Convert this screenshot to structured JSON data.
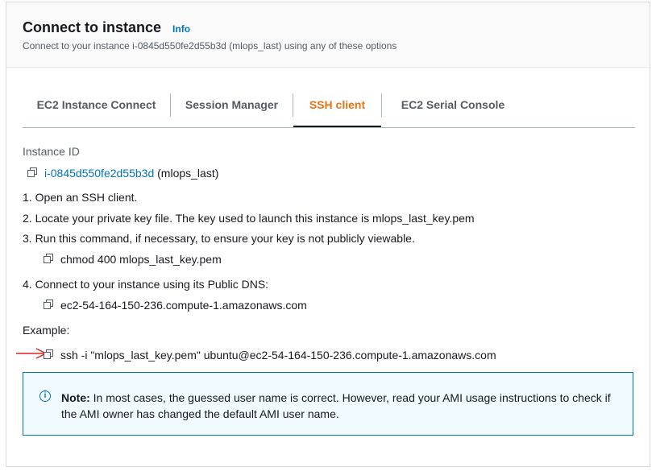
{
  "header": {
    "title": "Connect to instance",
    "info_link": "Info",
    "subtitle": "Connect to your instance i-0845d550fe2d55b3d (mlops_last) using any of these options"
  },
  "tabs": [
    {
      "label": "EC2 Instance Connect",
      "active": false
    },
    {
      "label": "Session Manager",
      "active": false
    },
    {
      "label": "SSH client",
      "active": true
    },
    {
      "label": "EC2 Serial Console",
      "active": false
    }
  ],
  "instance": {
    "label": "Instance ID",
    "id": "i-0845d550fe2d55b3d",
    "name": "(mlops_last)"
  },
  "steps": [
    "1. Open an SSH client.",
    "2. Locate your private key file. The key used to launch this instance is mlops_last_key.pem",
    "3. Run this command, if necessary, to ensure your key is not publicly viewable.",
    "4. Connect to your instance using its Public DNS:"
  ],
  "chmod_command": "chmod 400 mlops_last_key.pem",
  "public_dns": "ec2-54-164-150-236.compute-1.amazonaws.com",
  "example": {
    "label": "Example:",
    "command": "ssh -i \"mlops_last_key.pem\" ubuntu@ec2-54-164-150-236.compute-1.amazonaws.com"
  },
  "note": {
    "prefix": "Note:",
    "text": " In most cases, the guessed user name is correct. However, read your AMI usage instructions to check if the AMI owner has changed the default AMI user name."
  },
  "colors": {
    "accent": "#ec7211",
    "link": "#0073bb",
    "annotation_arrow": "#e02020"
  },
  "icons": [
    "copy-icon",
    "info-circle-icon",
    "red-arrow-annotation"
  ]
}
